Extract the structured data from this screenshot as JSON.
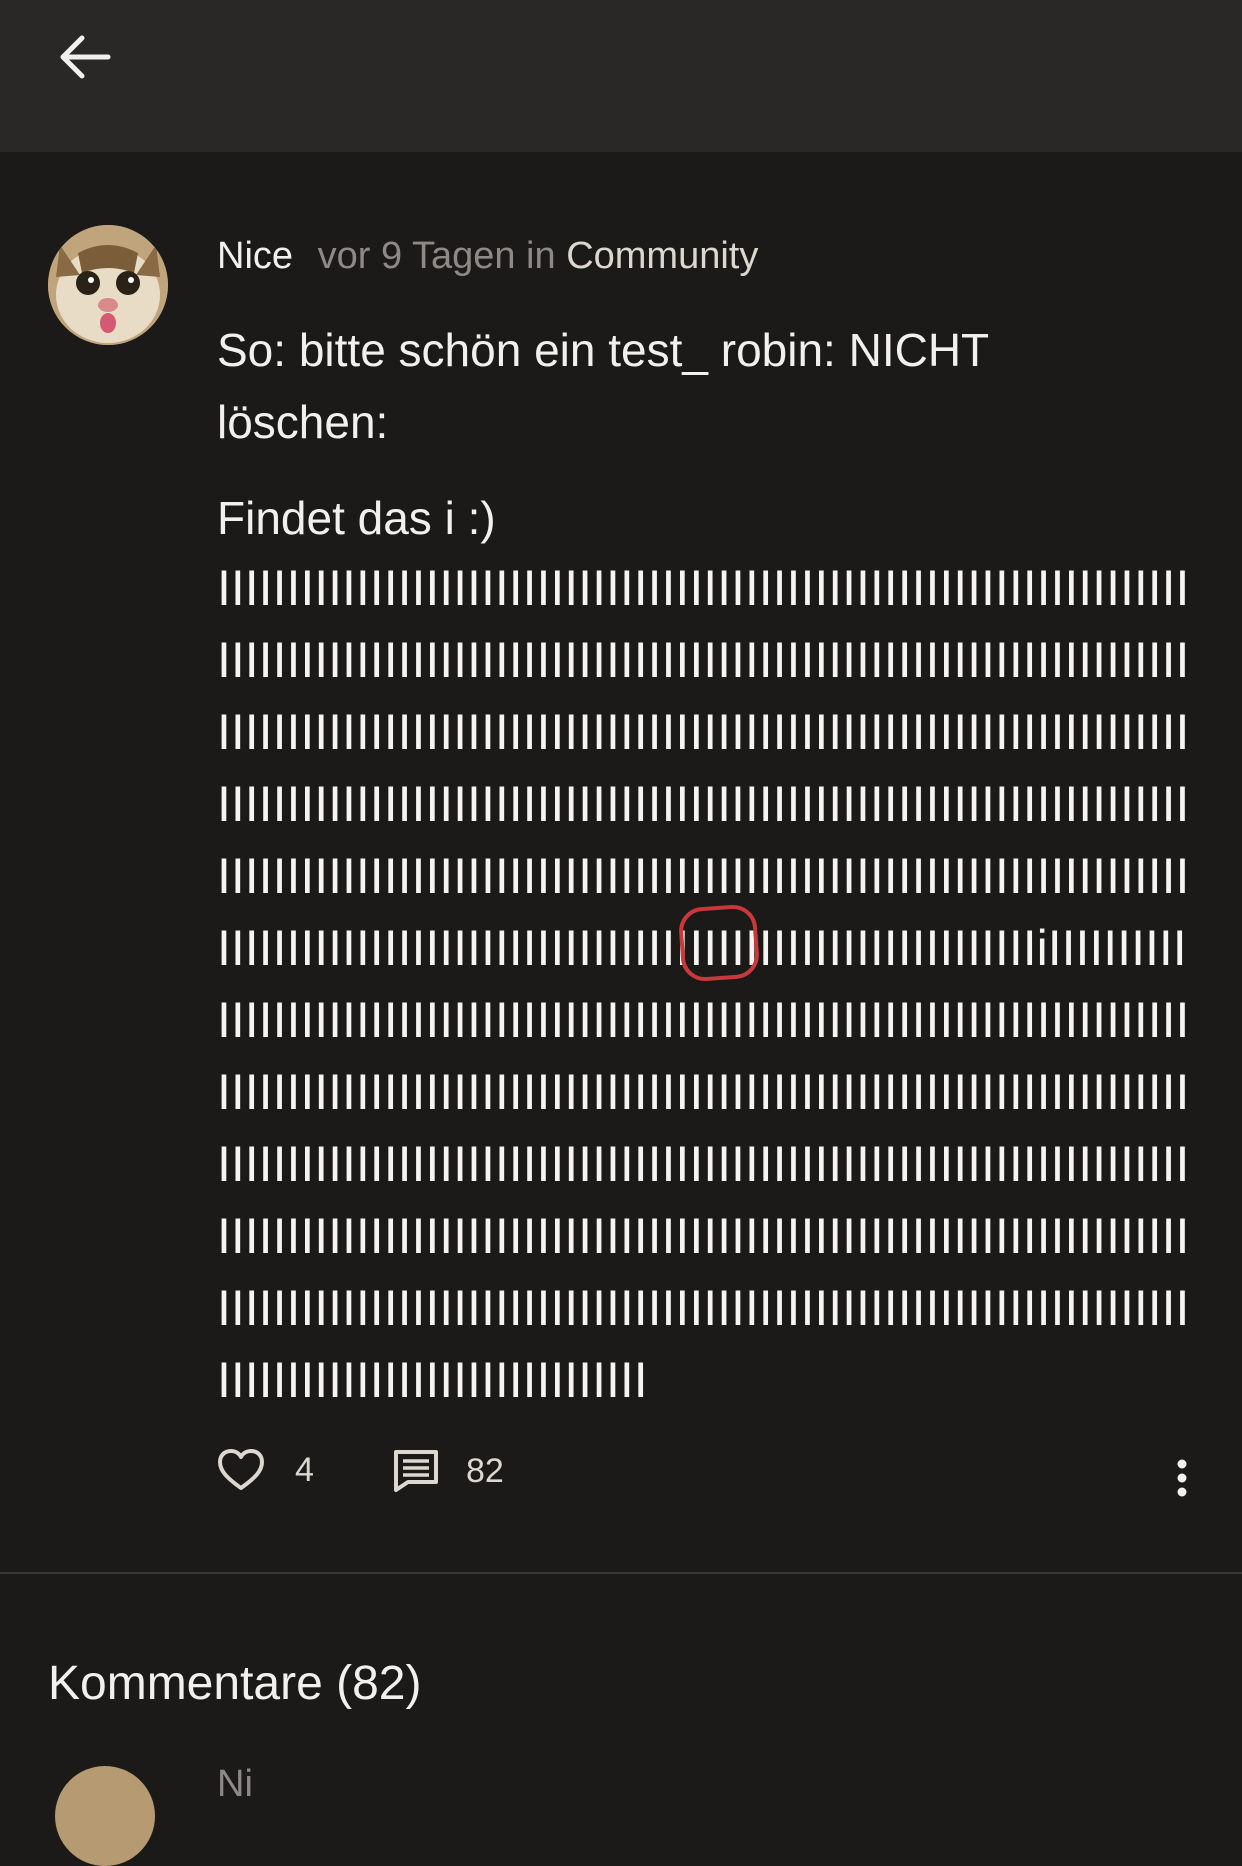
{
  "header": {
    "back_icon": "arrow-left-icon"
  },
  "post": {
    "author": "Nice",
    "time": "vor 9 Tagen",
    "in_word": "in",
    "community": "Community",
    "line1": "So: bitte schön ein test_ robin: NICHT",
    "line2": "löschen:",
    "line3": "Findet das i :)",
    "bar_rows": [
      "IIIIIIIIIIIIIIIIIIIIIIIIIIIIIIIIIIIIIIIIIIIIIIIIIIIIIIIIIIIIIIIIIIIIIIIIIIIIIIIIIIIIIIIIIIIIIIIIIIIIIIIIIIIIIIIIII",
      "IIIIIIIIIIIIIIIIIIIIIIIIIIIIIIIIIIIIIIIIIIIIIIIIIIIIIIIIIIIIIIIIIIIIIIIIIIIIIIIIIIIIIIIIIIIIIIIIIIIIIIIIIIIIIIIIII",
      "IIIIIIIIIIIIIIIIIIIIIIIIIIIIIIIIIIIIIIIIIIIIIIIIIIIIIIIIIIIIIIIIIIIIIIIIIIIIIIIIIIIIIIIIIIIIIIIIIIIIIIIIIIIIIIIIII",
      "IIIIIIIIIIIIIIIIIIIIIIIIIIIIIIIIIIIIIIIIIIIIIIIIIIIIIIIIIIIIIIIIIIIIIIIIIIIIIIIIIIIIIIIIIIIIIIIIIIIIIIIIIIIIIIIIII",
      "IIIIIIIIIIIIIIIIIIIIIIIIIIIIIIIIIIIIIIIIIIIIIIIIIIIIIIIIIIIIIIIIIIIIIIIIIIIIIIIIIIIIIIIIIIIIIIIIIIIIIIIIIIIIIIIIII",
      "IIIIIIIIIIIIIIIIIIIIIIIIIIIIIIIIIIIIIIIIIIIIIIIIIIIIIIIIIIIiIIIIIIIIIIIIIIIIIIIIIIIIIIIIIIIIIIIIIIIIIIIIIIIIIIIIII",
      "IIIIIIIIIIIIIIIIIIIIIIIIIIIIIIIIIIIIIIIIIIIIIIIIIIIIIIIIIIIIIIIIIIIIIIIIIIIIIIIIIIIIIIIIIIIIIIIIIIIIIIIIIIIIIIIIII",
      "IIIIIIIIIIIIIIIIIIIIIIIIIIIIIIIIIIIIIIIIIIIIIIIIIIIIIIIIIIIIIIIIIIIIIIIIIIIIIIIIIIIIIIIIIIIIIIIIIIIIIIIIIIIIIIIIII",
      "IIIIIIIIIIIIIIIIIIIIIIIIIIIIIIIIIIIIIIIIIIIIIIIIIIIIIIIIIIIIIIIIIIIIIIIIIIIIIIIIIIIIIIIIIIIIIIIIIIIIIIIIIIIIIIIIII",
      "IIIIIIIIIIIIIIIIIIIIIIIIIIIIIIIIIIIIIIIIIIIIIIIIIIIIIIIIIIIIIIIIIIIIIIIIIIIIIIIIIIIIIIIIIIIIIIIIIIIIIIIIIIIIIIIIII",
      "IIIIIIIIIIIIIIIIIIIIIIIIIIIIIIIIIIIIIIIIIIIIIIIIIIIIIIIIIIIIIIIIIIIIIIIIIIIIIIIIIIIIIIIIIIIIIIIIIIIIIIIIIIIIIIIIII",
      "IIIIIIIIIIIIIIIIIIIIIIIIIIIIIII"
    ],
    "likes": "4",
    "comments": "82",
    "like_icon": "heart-icon",
    "comment_icon": "comment-icon",
    "more_icon": "more-vertical-icon"
  },
  "comments_section": {
    "title": "Kommentare (82)",
    "first_comment_peek": "Ni"
  },
  "colors": {
    "background": "#1c1a19",
    "topbar": "#2a2826",
    "highlight": "#c8383c"
  }
}
